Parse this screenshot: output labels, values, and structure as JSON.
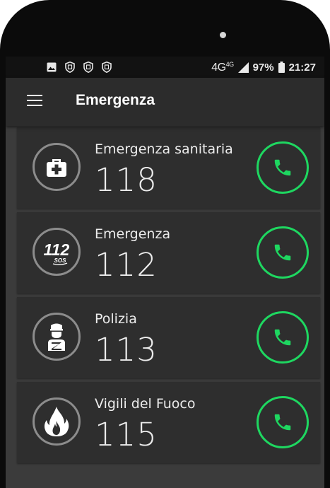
{
  "status_bar": {
    "network": "4G",
    "network_sup": "4G",
    "battery": "97%",
    "time": "21:27",
    "left_icons": [
      "image-notification-icon",
      "shield-notification-icon",
      "shield-notification-icon",
      "shield-notification-icon"
    ]
  },
  "toolbar": {
    "title": "Emergenza",
    "menu_icon": "hamburger-menu-icon"
  },
  "contacts": [
    {
      "label": "Emergenza sanitaria",
      "number": "118",
      "icon": "medical-kit-icon"
    },
    {
      "label": "Emergenza",
      "number": "112",
      "icon": "112-sos-icon",
      "icon_text": "112",
      "icon_subtext": "SOS"
    },
    {
      "label": "Polizia",
      "number": "113",
      "icon": "police-officer-icon"
    },
    {
      "label": "Vigili del Fuoco",
      "number": "115",
      "icon": "fire-icon"
    }
  ],
  "colors": {
    "accent_call": "#1ed760",
    "card_bg": "#2e2e2e",
    "toolbar_bg": "#2c2c2c",
    "screen_bg": "#3b3b3b"
  }
}
